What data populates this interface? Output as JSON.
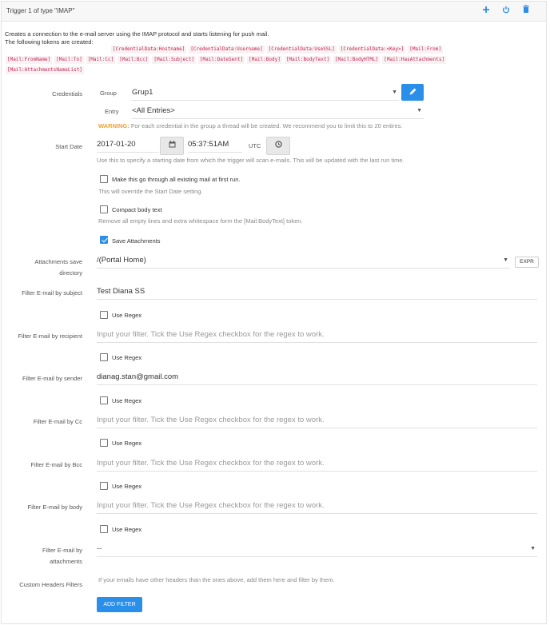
{
  "header": {
    "title": "Trigger 1 of type \"IMAP\"",
    "icons": [
      "plus-icon",
      "power-icon",
      "trash-icon"
    ]
  },
  "intro": {
    "line1": "Creates a connection to the e-mail server using the IMAP protocol and starts listening for push mail.",
    "line2": "The following tokens are created:",
    "tokens": [
      "[CredentialData:Hostname]",
      "[CredentialData:Username]",
      "[CredentialData:UseSSL]",
      "[CredentialData:<Key>]",
      "[Mail:From]",
      "[Mail:FromName]",
      "[Mail:To]",
      "[Mail:Cc]",
      "[Mail:Bcc]",
      "[Mail:Subject]",
      "[Mail:DateSent]",
      "[Mail:Body]",
      "[Mail:BodyText]",
      "[Mail:BodyHTML]",
      "[Mail:HasAttachments]",
      "[Mail:AttachmentsNameList]"
    ]
  },
  "credentials": {
    "label": "Credentials",
    "group_label": "Group",
    "group_value": "Grup1",
    "entry_label": "Entry",
    "entry_value": "<All Entries>",
    "warning_strong": "WARNING:",
    "warning_text": "For each credential in the group a thread will be created. We recommend you to limit this to 20 entires."
  },
  "start_date": {
    "label": "Start Date",
    "date": "2017-01-20",
    "time": "05:37:51AM",
    "tz": "UTC",
    "hint": "Use this to specify a starting date from which the trigger will scan e-mails. This will be updated with the last run time."
  },
  "options": {
    "existing_label": "Make this go through all existing mail at first run.",
    "existing_hint": "This will override the Start Date setting.",
    "existing_checked": false,
    "compact_label": "Compact body text",
    "compact_hint": "Remove all empty lines and extra whitespace form the [Mail:BodyText] token.",
    "compact_checked": false,
    "save_attach_label": "Save Attachments",
    "save_attach_checked": true
  },
  "attachments_dir": {
    "label_line1": "Attachments save",
    "label_line2": "directory",
    "value": "/(Portal Home)",
    "expr_label": "EXPR"
  },
  "filters": {
    "placeholder": "Input your filter. Tick the Use Regex checkbox for the regex to work.",
    "use_regex_label": "Use Regex",
    "subject_label": "Filter E-mail by subject",
    "subject_value": "Test Diana SS",
    "recipient_label": "Filter E-mail by recipient",
    "recipient_value": "",
    "sender_label": "Filter E-mail by sender",
    "sender_value": "dianag.stan@gmail.com",
    "cc_label": "Filter E-mail by Cc",
    "cc_value": "",
    "bcc_label": "Filter E-mail by Bcc",
    "bcc_value": "",
    "body_label": "Filter E-mail by body",
    "body_value": "",
    "attach_label_line1": "Filter E-mail by",
    "attach_label_line2": "attachments",
    "attach_value": "--"
  },
  "custom_headers": {
    "label": "Custom Headers Filters",
    "hint": "If your emails have other headers than the ones above, add them here and filter by them.",
    "button": "ADD FILTER"
  },
  "colors": {
    "accent": "#2a8fe8",
    "warning": "#f0a030",
    "token": "#c7254e"
  }
}
